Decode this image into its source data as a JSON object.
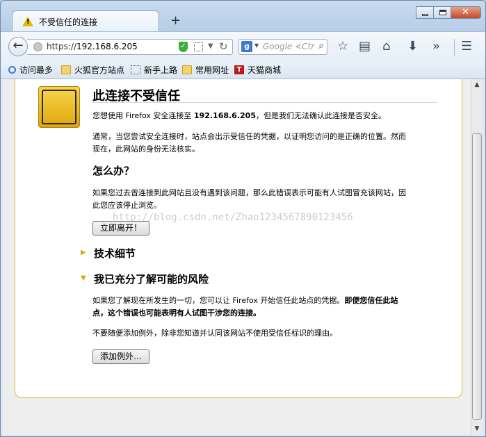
{
  "tab": {
    "title": "不受信任的连接",
    "warning_icon": "!"
  },
  "new_tab_label": "+",
  "nav": {
    "url_scheme": "https://",
    "url_host": "192.168.6.205",
    "search_placeholder": "Google <Ctr",
    "search_engine_letter": "g"
  },
  "bookmarks": [
    {
      "label": "访问最多",
      "icon": "search-icon"
    },
    {
      "label": "火狐官方站点",
      "icon": "folder-icon"
    },
    {
      "label": "新手上路",
      "icon": "dotted-box-icon"
    },
    {
      "label": "常用网址",
      "icon": "folder-icon"
    },
    {
      "label": "天猫商城",
      "icon": "tmall-icon",
      "icon_letter": "T"
    }
  ],
  "page": {
    "title": "此连接不受信任",
    "intro_prefix": "您想使用 Firefox 安全连接至 ",
    "intro_host": "192.168.6.205",
    "intro_suffix": "，但是我们无法确认此连接是否安全。",
    "para2_line1": "通常，当您尝试安全连接时，站点会出示受信任的凭据，以证明您访问的是正确的位置。然而",
    "para2_line2": "现在，此网站的身份无法核实。",
    "what_heading": "怎么办？",
    "what_line1": "如果您过去曾连接到此网站且没有遇到该问题，那么此错误表示可能有人试图冒充该网站，因",
    "what_line2": "此您应该停止浏览。",
    "leave_button": "立即离开！",
    "tech_heading": "技术细节",
    "risk_heading": "我已充分了解可能的风险",
    "risk_line1_normal": "如果您了解现在所发生的一切，您可以让 Firefox 开始信任此站点的凭据。",
    "risk_line1_bold": "即便您信任此站",
    "risk_line2_bold": "点，这个错误也可能表明有人试图干涉您的连接。",
    "risk_para2": "不要随便添加例外，除非您知道并认同该网站不使用受信任标识的理由。",
    "add_exception_button": "添加例外…",
    "watermark": "http://blog.csdn.net/Zhao1234567890123456"
  },
  "colors": {
    "accent_border": "#e5b92e",
    "badge": "#f0c020",
    "shield": "#3cae3c"
  }
}
